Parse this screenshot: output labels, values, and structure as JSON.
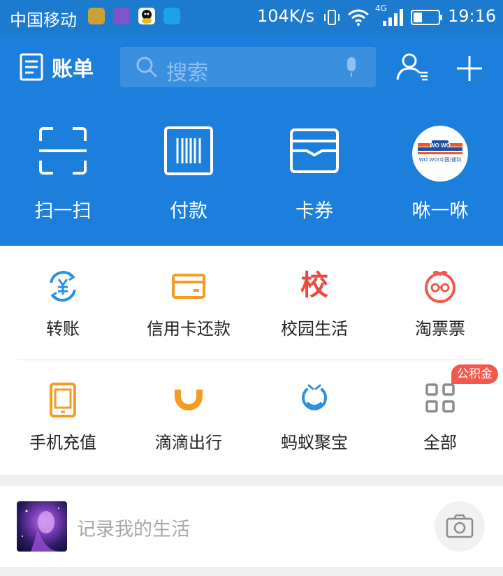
{
  "status_bar": {
    "carrier": "中国移动",
    "speed": "104K/s",
    "network": "4G",
    "time": "19:16",
    "colors": {
      "bg": "#1c7acf"
    }
  },
  "header": {
    "bill_label": "账单",
    "search_placeholder": "搜索",
    "colors": {
      "bg": "#1c7fdb",
      "search_bg": "#3b8fdf"
    }
  },
  "quick_actions": [
    {
      "label": "扫一扫",
      "icon": "scan-icon"
    },
    {
      "label": "付款",
      "icon": "barcode-icon"
    },
    {
      "label": "卡券",
      "icon": "card-wallet-icon"
    },
    {
      "label": "咻一咻",
      "icon": "wowo-logo-icon",
      "logo_text": "WO WO(中国)便利"
    }
  ],
  "grid": {
    "row1": [
      {
        "label": "转账",
        "icon": "transfer-icon",
        "color": "#2b90e0"
      },
      {
        "label": "信用卡还款",
        "icon": "credit-card-icon",
        "color": "#f59a23"
      },
      {
        "label": "校园生活",
        "icon": "campus-icon",
        "glyph": "校",
        "color": "#ea4b3c"
      },
      {
        "label": "淘票票",
        "icon": "taopiaopiao-icon",
        "color": "#ef5a4a"
      }
    ],
    "row2": [
      {
        "label": "手机充值",
        "icon": "phone-recharge-icon",
        "color": "#f59a23"
      },
      {
        "label": "滴滴出行",
        "icon": "didi-icon",
        "color": "#f59a23"
      },
      {
        "label": "蚂蚁聚宝",
        "icon": "ant-fortune-icon",
        "color": "#2b90e0"
      },
      {
        "label": "全部",
        "icon": "grid-all-icon",
        "color": "#8c8c8c"
      }
    ],
    "badge": "公积金"
  },
  "post": {
    "placeholder": "记录我的生活"
  }
}
